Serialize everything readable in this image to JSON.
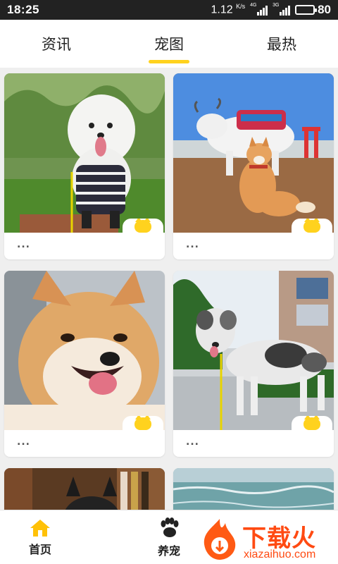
{
  "status_bar": {
    "time": "18:25",
    "network_speed": "1.12",
    "network_unit": "K/s",
    "sim1_tag": "4G",
    "sim2_tag": "3G",
    "battery": "80",
    "battery_level_percent": 80
  },
  "tabs": [
    {
      "label": "资讯",
      "active": false
    },
    {
      "label": "宠图",
      "active": true
    },
    {
      "label": "最热",
      "active": false
    }
  ],
  "accent_color": "#ffd21e",
  "grid": {
    "cards": [
      {
        "caption": "...",
        "image": "white-samoyed-in-striped-sweater"
      },
      {
        "caption": "...",
        "image": "shiba-inu-with-decorated-yak"
      },
      {
        "caption": "...",
        "image": "smiling-shiba-inu-closeup"
      },
      {
        "caption": "...",
        "image": "merle-australian-shepherd-puppy"
      },
      {
        "caption": "",
        "image": "dark-dog-by-bookshelf"
      },
      {
        "caption": "",
        "image": "sea-shore"
      }
    ]
  },
  "bottom_nav": {
    "items": [
      {
        "label": "首页",
        "icon": "home-icon",
        "active": true
      },
      {
        "label": "养宠",
        "icon": "paw-icon",
        "active": false
      }
    ],
    "home_icon_color": "#ffc107"
  },
  "watermark": {
    "title": "下载火",
    "subtitle": "xiazaihuo.com",
    "color": "#ff4a12"
  }
}
